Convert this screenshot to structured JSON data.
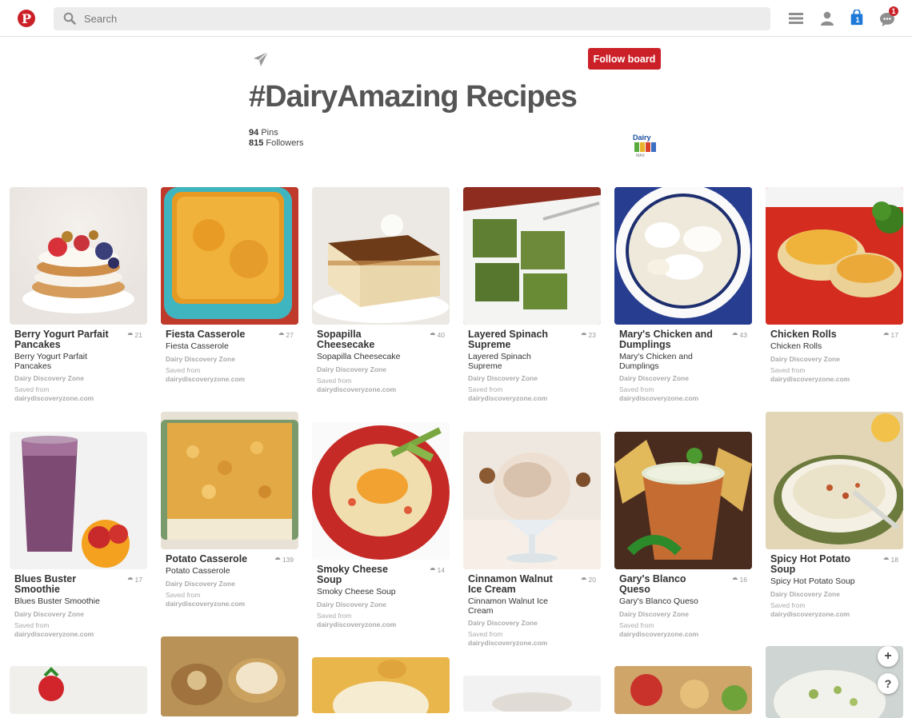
{
  "header": {
    "logo": "P",
    "search_placeholder": "Search",
    "bag_count": "1",
    "notification_count": "1"
  },
  "board": {
    "follow_label": "Follow board",
    "title": "#DairyAmazing Recipes",
    "pins_count": "94",
    "pins_label": "Pins",
    "followers_count": "815",
    "followers_label": "Followers",
    "owner_logo_text": "Dairy MAX"
  },
  "pins": [
    {
      "title": "Berry Yogurt Parfait Pancakes",
      "repins": "21",
      "desc": "Berry Yogurt Parfait Pancakes",
      "source": "Dairy Discovery Zone",
      "saved_label": "Saved from",
      "domain": "dairydiscoveryzone.com"
    },
    {
      "title": "Fiesta Casserole",
      "repins": "27",
      "desc": "Fiesta Casserole",
      "source": "Dairy Discovery Zone",
      "saved_label": "Saved from",
      "domain": "dairydiscoveryzone.com"
    },
    {
      "title": "Sopapilla Cheesecake",
      "repins": "40",
      "desc": "Sopapilla Cheesecake",
      "source": "Dairy Discovery Zone",
      "saved_label": "Saved from",
      "domain": "dairydiscoveryzone.com"
    },
    {
      "title": "Layered Spinach Supreme",
      "repins": "23",
      "desc": "Layered Spinach Supreme",
      "source": "Dairy Discovery Zone",
      "saved_label": "Saved from",
      "domain": "dairydiscoveryzone.com"
    },
    {
      "title": "Mary's Chicken and Dumplings",
      "repins": "43",
      "desc": "Mary's Chicken and Dumplings",
      "source": "Dairy Discovery Zone",
      "saved_label": "Saved from",
      "domain": "dairydiscoveryzone.com"
    },
    {
      "title": "Chicken Rolls",
      "repins": "17",
      "desc": "Chicken Rolls",
      "source": "Dairy Discovery Zone",
      "saved_label": "Saved from",
      "domain": "dairydiscoveryzone.com"
    },
    {
      "title": "Blues Buster Smoothie",
      "repins": "17",
      "desc": "Blues Buster Smoothie",
      "source": "Dairy Discovery Zone",
      "saved_label": "Saved from",
      "domain": "dairydiscoveryzone.com"
    },
    {
      "title": "Potato Casserole",
      "repins": "139",
      "desc": "Potato Casserole",
      "source": "Dairy Discovery Zone",
      "saved_label": "Saved from",
      "domain": "dairydiscoveryzone.com"
    },
    {
      "title": "Smoky Cheese Soup",
      "repins": "14",
      "desc": "Smoky Cheese Soup",
      "source": "Dairy Discovery Zone",
      "saved_label": "Saved from",
      "domain": "dairydiscoveryzone.com"
    },
    {
      "title": "Cinnamon Walnut Ice Cream",
      "repins": "20",
      "desc": "Cinnamon Walnut Ice Cream",
      "source": "Dairy Discovery Zone",
      "saved_label": "Saved from",
      "domain": "dairydiscoveryzone.com"
    },
    {
      "title": "Gary's Blanco Queso",
      "repins": "16",
      "desc": "Gary's Blanco Queso",
      "source": "Dairy Discovery Zone",
      "saved_label": "Saved from",
      "domain": "dairydiscoveryzone.com"
    },
    {
      "title": "Spicy Hot Potato Soup",
      "repins": "18",
      "desc": "Spicy Hot Potato Soup",
      "source": "Dairy Discovery Zone",
      "saved_label": "Saved from",
      "domain": "dairydiscoveryzone.com"
    }
  ],
  "fab": {
    "add": "+",
    "help": "?"
  },
  "colors": {
    "brand": "#cb2027",
    "muted": "#aaaaaa"
  }
}
